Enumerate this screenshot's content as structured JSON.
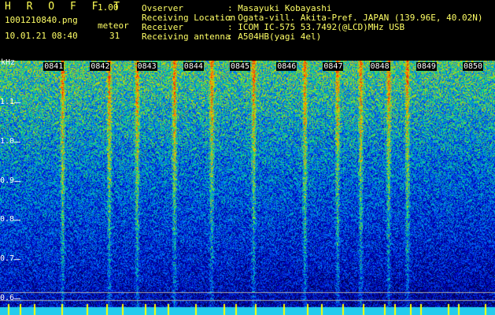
{
  "header": {
    "logo": "H R O F F T",
    "version": "1.00",
    "filename": "1001210840.png",
    "datetime": "10.01.21 08:40",
    "meteor_label": "meteor",
    "meteor_count": "31",
    "fields": [
      {
        "label": "Ovserver",
        "value": ": Masayuki Kobayashi"
      },
      {
        "label": "Receiving Location",
        "value": ": Ogata-vill. Akita-Pref. JAPAN (139.96E, 40.02N)"
      },
      {
        "label": "Receiver",
        "value": ": ICOM IC-575 53.7492(@LCD)MHz USB"
      },
      {
        "label": "Receiving antenna",
        "value": ": A504HB(yagi 4el)"
      }
    ]
  },
  "chart_data": {
    "type": "heatmap",
    "ylabel": "kHz",
    "yticks": [
      "1.1",
      "1.0",
      "0.9",
      "0.8",
      "0.7",
      "0.6"
    ],
    "xticks": [
      "0841",
      "0842",
      "0843",
      "0844",
      "0845",
      "0846",
      "0847",
      "0848",
      "0849",
      "0850"
    ],
    "ylim": [
      0.58,
      1.2
    ],
    "time_range": [
      "0840",
      "0850"
    ],
    "meteor_trails_minutes": [
      1.0,
      2.0,
      2.6,
      3.4,
      4.2,
      5.1,
      6.2,
      6.9,
      7.4,
      8.0,
      8.4
    ]
  },
  "colors": {
    "text": "#ffff55",
    "tick": "#ffffff",
    "background": "#000000"
  }
}
